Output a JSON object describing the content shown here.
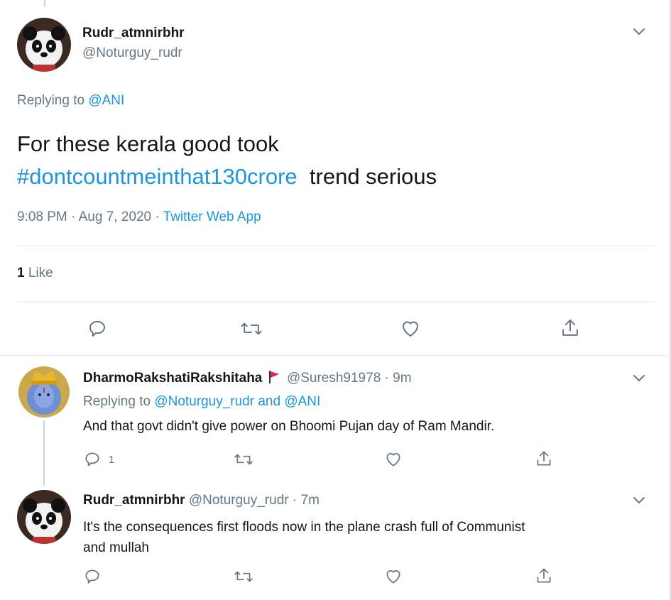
{
  "main_tweet": {
    "display_name": "Rudr_atmnirbhr",
    "handle": "@Noturguy_rudr",
    "replying_prefix": "Replying to",
    "replying_to": "@ANI",
    "text_line1": "For these kerala good took",
    "hashtag": "#dontcountmeinthat130crore",
    "text_line2_rest": "trend serious",
    "time": "9:08 PM",
    "date": "Aug 7, 2020",
    "source": "Twitter Web App",
    "sep": "·",
    "likes_count": "1",
    "likes_label": "Like"
  },
  "replies": [
    {
      "display_name": "DharmoRakshatiRakshitaha",
      "handle": "@Suresh91978",
      "sep": "·",
      "time": "9m",
      "replying_prefix": "Replying to",
      "replying_to": "@Noturguy_rudr and @ANI",
      "text": "And that govt didn't give power on Bhoomi Pujan day of Ram Mandir.",
      "reply_count": "1",
      "flag_color": "#e0245e"
    },
    {
      "display_name": "Rudr_atmnirbhr",
      "handle": "@Noturguy_rudr",
      "sep": "·",
      "time": "7m",
      "text_line1": "It's the consequences first floods now in the plane crash full of Communist",
      "text_line2": "and mullah"
    }
  ],
  "icons": {
    "reply": "reply-icon",
    "retweet": "retweet-icon",
    "like": "heart-icon",
    "share": "share-icon",
    "more": "chevron-down-icon"
  },
  "colors": {
    "link": "#1b95e0",
    "muted": "#657786",
    "text": "#14171a",
    "divider": "#e6ecf0"
  }
}
